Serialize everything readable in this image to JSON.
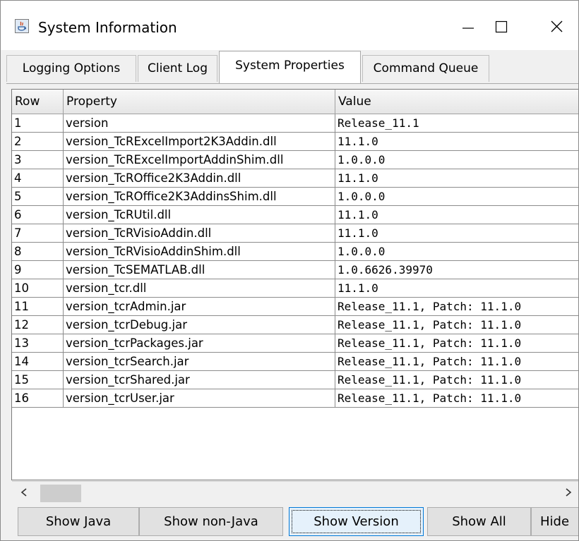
{
  "window": {
    "title": "System Information"
  },
  "tabs": [
    {
      "label": "Logging Options"
    },
    {
      "label": "Client Log"
    },
    {
      "label": "System Properties"
    },
    {
      "label": "Command Queue"
    }
  ],
  "table": {
    "headers": {
      "row": "Row",
      "property": "Property",
      "value": "Value"
    },
    "rows": [
      {
        "row": "1",
        "property": "version",
        "value": "Release_11.1"
      },
      {
        "row": "2",
        "property": "version_TcRExcelImport2K3Addin.dll",
        "value": "11.1.0"
      },
      {
        "row": "3",
        "property": "version_TcRExcelImportAddinShim.dll",
        "value": "1.0.0.0"
      },
      {
        "row": "4",
        "property": "version_TcROffice2K3Addin.dll",
        "value": "11.1.0"
      },
      {
        "row": "5",
        "property": "version_TcROffice2K3AddinsShim.dll",
        "value": "1.0.0.0"
      },
      {
        "row": "6",
        "property": "version_TcRUtil.dll",
        "value": "11.1.0"
      },
      {
        "row": "7",
        "property": "version_TcRVisioAddin.dll",
        "value": "11.1.0"
      },
      {
        "row": "8",
        "property": "version_TcRVisioAddinShim.dll",
        "value": "1.0.0.0"
      },
      {
        "row": "9",
        "property": "version_TcSEMATLAB.dll",
        "value": "1.0.6626.39970"
      },
      {
        "row": "10",
        "property": "version_tcr.dll",
        "value": "11.1.0"
      },
      {
        "row": "11",
        "property": "version_tcrAdmin.jar",
        "value": "Release_11.1, Patch: 11.1.0"
      },
      {
        "row": "12",
        "property": "version_tcrDebug.jar",
        "value": "Release_11.1, Patch: 11.1.0"
      },
      {
        "row": "13",
        "property": "version_tcrPackages.jar",
        "value": "Release_11.1, Patch: 11.1.0"
      },
      {
        "row": "14",
        "property": "version_tcrSearch.jar",
        "value": "Release_11.1, Patch: 11.1.0"
      },
      {
        "row": "15",
        "property": "version_tcrShared.jar",
        "value": "Release_11.1, Patch: 11.1.0"
      },
      {
        "row": "16",
        "property": "version_tcrUser.jar",
        "value": "Release_11.1, Patch: 11.1.0"
      }
    ]
  },
  "buttons": {
    "show_java": "Show Java",
    "show_non_java": "Show non-Java",
    "show_version": "Show Version",
    "show_all": "Show All",
    "hide": "Hide"
  },
  "icons": {
    "app": "java-app-icon",
    "minimize": "minimize-icon",
    "maximize": "maximize-icon",
    "close": "close-icon",
    "scroll_left": "chevron-left-icon",
    "scroll_right": "chevron-right-icon"
  },
  "colors": {
    "focus_border": "#0078d7",
    "button_face": "#e1e1e1",
    "panel": "#f0f0f0"
  }
}
